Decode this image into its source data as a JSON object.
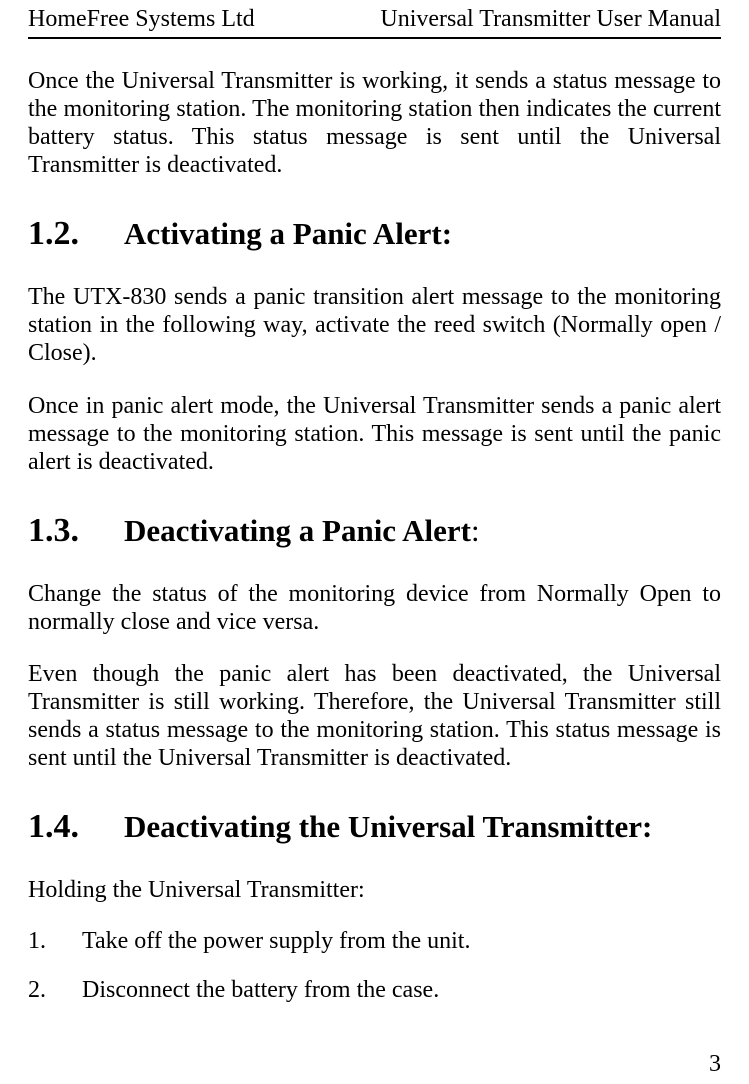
{
  "header": {
    "left": "HomeFree Systems Ltd",
    "right": "Universal Transmitter User Manual"
  },
  "intro_paragraph": "Once the Universal Transmitter is working, it sends a status message to the monitoring station. The monitoring station then indicates the current battery status. This status message is sent until the Universal Transmitter is deactivated.",
  "sections": {
    "s12": {
      "number": "1.2.",
      "title": "Activating a Panic Alert:",
      "p1": "The UTX-830 sends a panic transition alert message to the monitoring station in the following way, activate the reed switch (Normally open / Close).",
      "p2": "Once in panic alert mode, the Universal Transmitter sends a panic alert message to the monitoring station. This message is sent until the panic alert is deactivated."
    },
    "s13": {
      "number": "1.3.",
      "title": "Deactivating a Panic Alert",
      "title_suffix": ":",
      "p1": "Change the status of the monitoring device from Normally Open to normally close and vice versa.",
      "p2": "Even though the panic alert has been deactivated, the Universal Transmitter is still working. Therefore, the Universal Transmitter still sends a status message to the monitoring station. This status message is sent until the Universal Transmitter is deactivated."
    },
    "s14": {
      "number": "1.4.",
      "title": "Deactivating the Universal Transmitter:",
      "p1": "Holding the Universal Transmitter:",
      "list": {
        "i1": {
          "num": "1.",
          "text": "Take off the power supply from the unit."
        },
        "i2": {
          "num": "2.",
          "text": "Disconnect the battery from the case."
        }
      }
    }
  },
  "page_number": "3"
}
